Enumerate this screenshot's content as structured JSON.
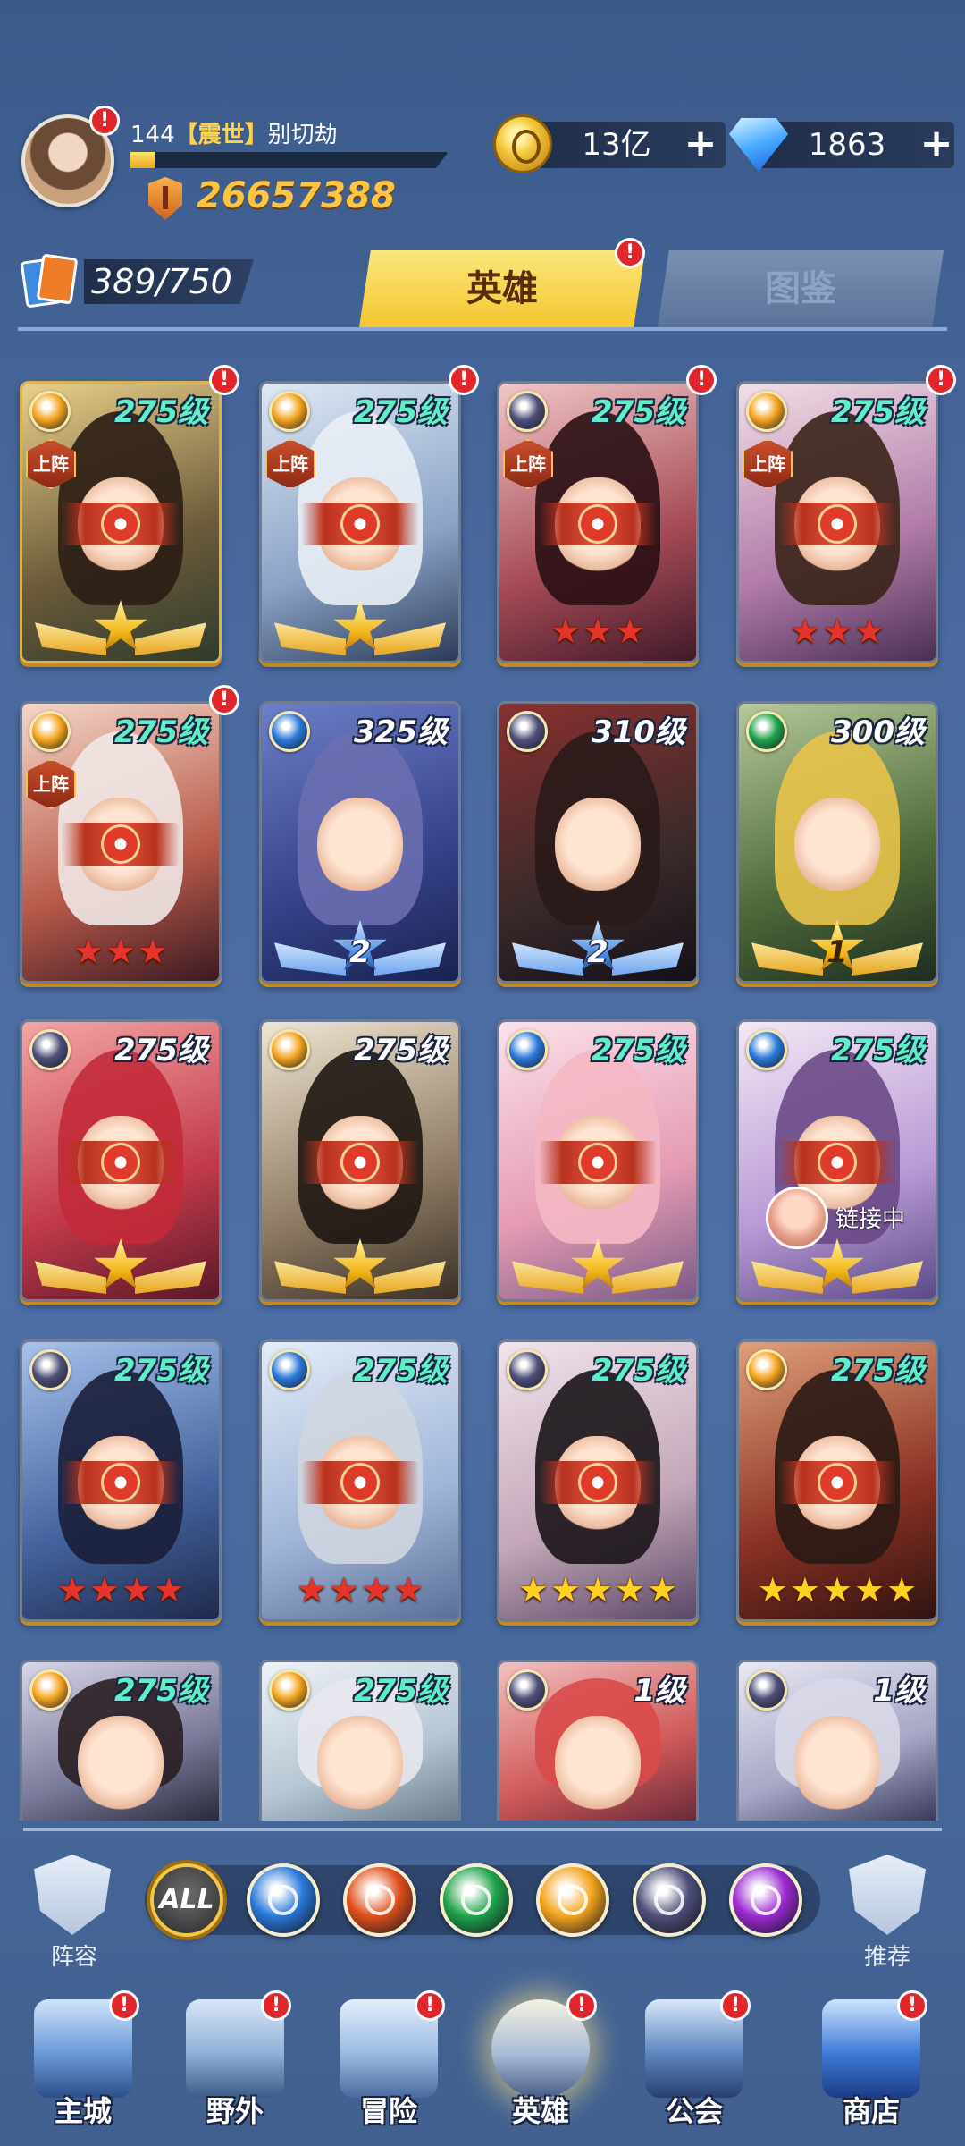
{
  "player": {
    "level": "144",
    "guild": "【震世】",
    "name": "别切劫",
    "xp_fraction": 0.08,
    "power": "26657388"
  },
  "resources": {
    "gold": "13亿",
    "gems": "1863",
    "plus": "+"
  },
  "hero_count": "389/750",
  "tabs": {
    "heroes": "英雄",
    "codex": "图鉴"
  },
  "badge_mark": "!",
  "heroes": [
    {
      "level": "275级",
      "level_color": "teal",
      "on_team": "上阵",
      "stars_type": "big-gold",
      "element": "light",
      "badge": true
    },
    {
      "level": "275级",
      "level_color": "teal",
      "on_team": "上阵",
      "stars_type": "big-gold",
      "element": "light",
      "badge": true
    },
    {
      "level": "275级",
      "level_color": "teal",
      "on_team": "上阵",
      "stars_type": "red",
      "star_count": 3,
      "element": "void",
      "badge": true
    },
    {
      "level": "275级",
      "level_color": "teal",
      "on_team": "上阵",
      "stars_type": "red",
      "star_count": 3,
      "element": "light",
      "badge": true
    },
    {
      "level": "275级",
      "level_color": "teal",
      "on_team": "上阵",
      "stars_type": "red",
      "star_count": 3,
      "element": "light",
      "badge": true
    },
    {
      "level": "325级",
      "level_color": "white",
      "stars_type": "big-blue",
      "star_number": "2",
      "element": "water"
    },
    {
      "level": "310级",
      "level_color": "white",
      "stars_type": "big-blue",
      "star_number": "2",
      "element": "void"
    },
    {
      "level": "300级",
      "level_color": "white",
      "stars_type": "big-gold",
      "star_number": "1",
      "element": "wind"
    },
    {
      "level": "275级",
      "level_color": "white",
      "stars_type": "big-gold",
      "element": "void"
    },
    {
      "level": "275级",
      "level_color": "white",
      "stars_type": "big-gold",
      "element": "light"
    },
    {
      "level": "275级",
      "level_color": "teal",
      "stars_type": "big-gold",
      "element": "water"
    },
    {
      "level": "275级",
      "level_color": "teal",
      "stars_type": "big-gold",
      "element": "water",
      "link_text": "链接中"
    },
    {
      "level": "275级",
      "level_color": "teal",
      "stars_type": "red",
      "star_count": 4,
      "element": "void"
    },
    {
      "level": "275级",
      "level_color": "teal",
      "stars_type": "red",
      "star_count": 4,
      "element": "water"
    },
    {
      "level": "275级",
      "level_color": "teal",
      "stars_type": "gold",
      "star_count": 5,
      "element": "void"
    },
    {
      "level": "275级",
      "level_color": "teal",
      "stars_type": "gold",
      "star_count": 5,
      "element": "light"
    },
    {
      "level": "275级",
      "level_color": "teal",
      "element": "light"
    },
    {
      "level": "275级",
      "level_color": "teal",
      "element": "light"
    },
    {
      "level": "1级",
      "level_color": "white",
      "element": "void"
    },
    {
      "level": "1级",
      "level_color": "white",
      "element": "void"
    }
  ],
  "filter": {
    "lineup_label": "阵容",
    "recommend_label": "推荐",
    "all_label": "ALL",
    "elements": [
      "water",
      "fire",
      "wind",
      "light",
      "void",
      "dark"
    ]
  },
  "nav": [
    {
      "label": "主城",
      "icon": "castle-icon",
      "badge": true
    },
    {
      "label": "野外",
      "icon": "portal-icon",
      "badge": true
    },
    {
      "label": "冒险",
      "icon": "sword-gate-icon",
      "badge": true
    },
    {
      "label": "英雄",
      "icon": "helmet-icon",
      "badge": true,
      "active": true
    },
    {
      "label": "公会",
      "icon": "banner-icon",
      "badge": true
    },
    {
      "label": "商店",
      "icon": "shop-icon",
      "badge": true
    }
  ],
  "colors": {
    "water": "#2a78d8",
    "fire": "#e0501c",
    "wind": "#1fa24a",
    "light": "#f3a41c",
    "void": "#4d4f78",
    "dark": "#9b2ad0"
  }
}
